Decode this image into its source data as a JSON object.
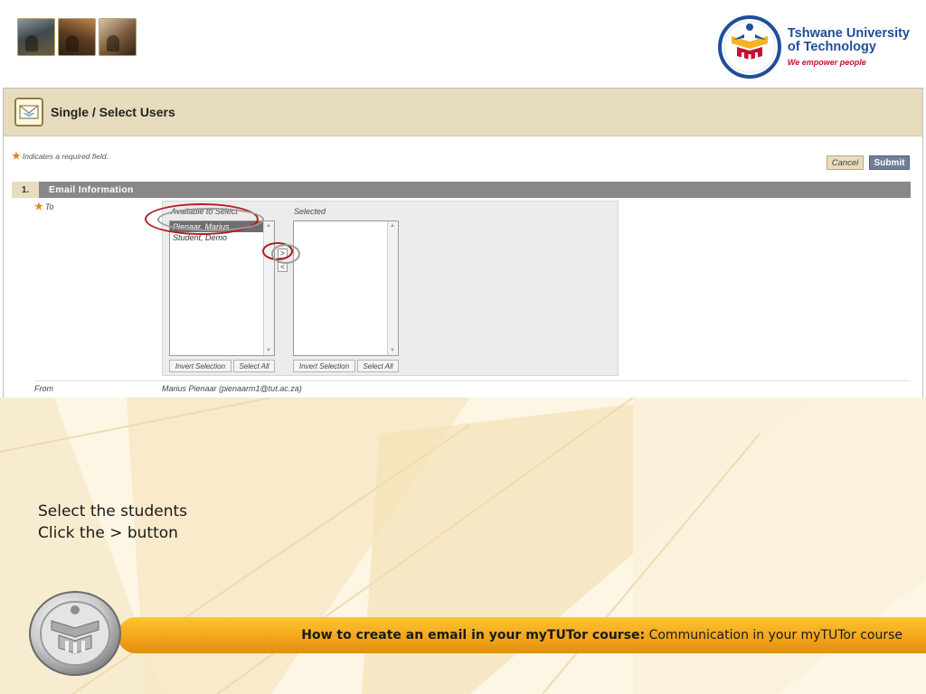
{
  "brand": {
    "name_line1": "Tshwane University",
    "name_line2": "of Technology",
    "tagline": "We empower people"
  },
  "page": {
    "title": "Single / Select Users",
    "required_note": "Indicates a required field.",
    "required_star": "★"
  },
  "actions": {
    "cancel_label": "Cancel",
    "submit_label": "Submit"
  },
  "section": {
    "number": "1.",
    "title": "Email Information"
  },
  "to_field": {
    "label": "To",
    "available_header": "Available to Select",
    "selected_header": "Selected",
    "available_options": [
      {
        "label": "Pienaar, Marius",
        "selected": true
      },
      {
        "label": "Student, Demo",
        "selected": false
      }
    ],
    "selected_options": [],
    "move_right_label": ">",
    "move_left_label": "<",
    "invert_selection_label": "Invert Selection",
    "select_all_label": "Select All"
  },
  "from_field": {
    "label": "From",
    "value": "Marius Pienaar (pienaarm1@tut.ac.za)"
  },
  "instructions": {
    "line1": "Select the students",
    "line2": "Click the > button"
  },
  "footer": {
    "bold_text": "How to create an email in your myTUTor course:",
    "normal_text": "Communication in your myTUTor course"
  },
  "colors": {
    "header_bg": "#e7dbbd",
    "section_bar": "#888888",
    "submit_bg": "#6f7f99",
    "highlight_ring": "#b01e23",
    "footer_gold": "#f4a61c",
    "brand_blue": "#1f4e9a",
    "brand_red": "#c8102e"
  },
  "icons": [
    "photo-thumbnail",
    "university-crest-icon",
    "envelope-icon",
    "required-star-icon",
    "scroll-arrow-icon"
  ]
}
